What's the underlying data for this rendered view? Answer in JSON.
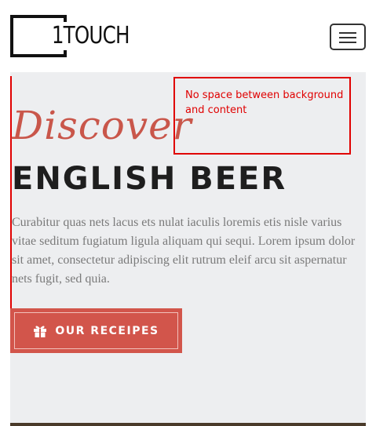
{
  "header": {
    "logo_text": "1TOUCH",
    "menu_icon": "hamburger-menu-icon"
  },
  "hero": {
    "script_title": "Discover",
    "headline": "ENGLISH BEER",
    "lead": "Curabitur quas nets lacus ets nulat iaculis loremis etis nisle varius vitae seditum fugiatum ligula aliquam qui sequi. Lorem ipsum dolor sit amet, consectetur adipiscing elit rutrum eleif arcu sit aspernatur nets fugit, sed quia.",
    "button_label": "OUR RECEIPES",
    "button_icon": "gift-icon"
  },
  "annotation": {
    "note": "No space between background and content"
  },
  "colors": {
    "accent": "#d2554b",
    "annotation": "#e00000",
    "hero_bg": "#edeef0",
    "headline": "#1e1e1e"
  }
}
